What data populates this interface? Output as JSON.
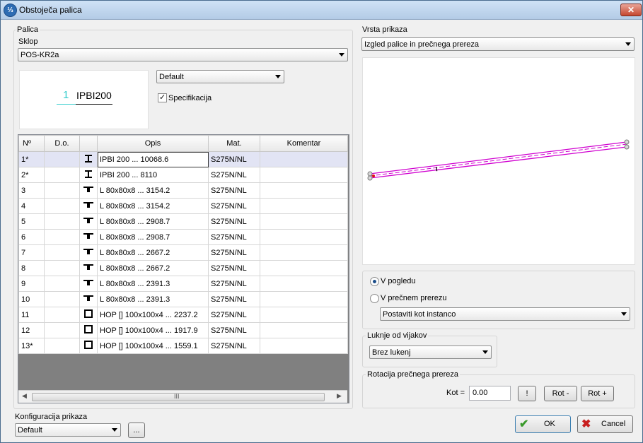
{
  "window": {
    "title": "Obstoječa palica",
    "close_glyph": "✕",
    "app_icon_glyph": "⅓"
  },
  "left": {
    "palica_label": "Palica",
    "sklop_label": "Sklop",
    "sklop_value": "POS-KR2a",
    "preview": {
      "number": "1",
      "profile": "IPBI200"
    },
    "default_combo": "Default",
    "specifikacija_label": "Specifikacija",
    "specifikacija_checked": true
  },
  "table": {
    "headers": [
      "Nº",
      "D.o.",
      "",
      "Opis",
      "Mat.",
      "Komentar"
    ],
    "rows": [
      {
        "no": "1*",
        "do": "",
        "icon": "I",
        "opis": "IPBI  200 ... 10068.6",
        "mat": "S275N/NL",
        "kom": ""
      },
      {
        "no": "2*",
        "do": "",
        "icon": "I",
        "opis": "IPBI  200 ... 8110",
        "mat": "S275N/NL",
        "kom": ""
      },
      {
        "no": "3",
        "do": "",
        "icon": "L",
        "opis": "L  80x80x8 ... 3154.2",
        "mat": "S275N/NL",
        "kom": ""
      },
      {
        "no": "4",
        "do": "",
        "icon": "L",
        "opis": "L  80x80x8 ... 3154.2",
        "mat": "S275N/NL",
        "kom": ""
      },
      {
        "no": "5",
        "do": "",
        "icon": "L",
        "opis": "L  80x80x8 ... 2908.7",
        "mat": "S275N/NL",
        "kom": ""
      },
      {
        "no": "6",
        "do": "",
        "icon": "L",
        "opis": "L  80x80x8 ... 2908.7",
        "mat": "S275N/NL",
        "kom": ""
      },
      {
        "no": "7",
        "do": "",
        "icon": "L",
        "opis": "L  80x80x8 ... 2667.2",
        "mat": "S275N/NL",
        "kom": ""
      },
      {
        "no": "8",
        "do": "",
        "icon": "L",
        "opis": "L  80x80x8 ... 2667.2",
        "mat": "S275N/NL",
        "kom": ""
      },
      {
        "no": "9",
        "do": "",
        "icon": "L",
        "opis": "L  80x80x8 ... 2391.3",
        "mat": "S275N/NL",
        "kom": ""
      },
      {
        "no": "10",
        "do": "",
        "icon": "L",
        "opis": "L  80x80x8 ... 2391.3",
        "mat": "S275N/NL",
        "kom": ""
      },
      {
        "no": "11",
        "do": "",
        "icon": "box",
        "opis": "HOP []  100x100x4 ... 2237.2",
        "mat": "S275N/NL",
        "kom": ""
      },
      {
        "no": "12",
        "do": "",
        "icon": "box",
        "opis": "HOP []  100x100x4 ... 1917.9",
        "mat": "S275N/NL",
        "kom": ""
      },
      {
        "no": "13*",
        "do": "",
        "icon": "box",
        "opis": "HOP []  100x100x4 ... 1559.1",
        "mat": "S275N/NL",
        "kom": ""
      }
    ],
    "scroll_grip": "III"
  },
  "config": {
    "label": "Konfiguracija prikaza",
    "value": "Default",
    "more_button": "..."
  },
  "right": {
    "vrsta_label": "Vrsta prikaza",
    "vrsta_value": "Izgled palice in prečnega prereza",
    "view_mark": "I",
    "radio_pogled": "V pogledu",
    "radio_prerez": "V prečnem prerezu",
    "radio_selected": "pogled",
    "instance_combo": "Postaviti kot instanco",
    "luknje_label": "Luknje od vijakov",
    "luknje_value": "Brez lukenj",
    "rotacija_label": "Rotacija prečnega prereza",
    "kot_label": "Kot =",
    "kot_value": "0.00",
    "excl_button": "!",
    "rot_minus": "Rot -",
    "rot_plus": "Rot +"
  },
  "buttons": {
    "ok": "OK",
    "cancel": "Cancel"
  },
  "colors": {
    "member": "#d000d0",
    "preview_number": "#33cccc",
    "ok_check": "#3a9a2c",
    "cancel_x": "#c81e1e",
    "selected_row": "#e2e4f4"
  }
}
